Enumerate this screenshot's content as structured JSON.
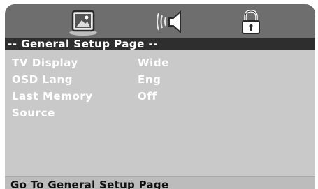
{
  "icon_bar": {
    "icons": [
      {
        "name": "general-setup-icon",
        "selected": true
      },
      {
        "name": "audio-speaker-icon",
        "selected": false
      },
      {
        "name": "lock-icon",
        "selected": false
      }
    ]
  },
  "page": {
    "title": "-- General Setup Page --"
  },
  "menu": {
    "items": [
      {
        "label": "TV Display",
        "value": "Wide"
      },
      {
        "label": "OSD Lang",
        "value": "Eng"
      },
      {
        "label": "Last Memory",
        "value": "Off"
      },
      {
        "label": "Source",
        "value": ""
      }
    ]
  },
  "status": {
    "text": "Go To General Setup Page"
  },
  "colors": {
    "background": "#c9c9c9",
    "icon_bar": "#6e6e6e",
    "title_bar": "#2e2e2e",
    "text": "#ffffff",
    "status_text": "#111111"
  }
}
